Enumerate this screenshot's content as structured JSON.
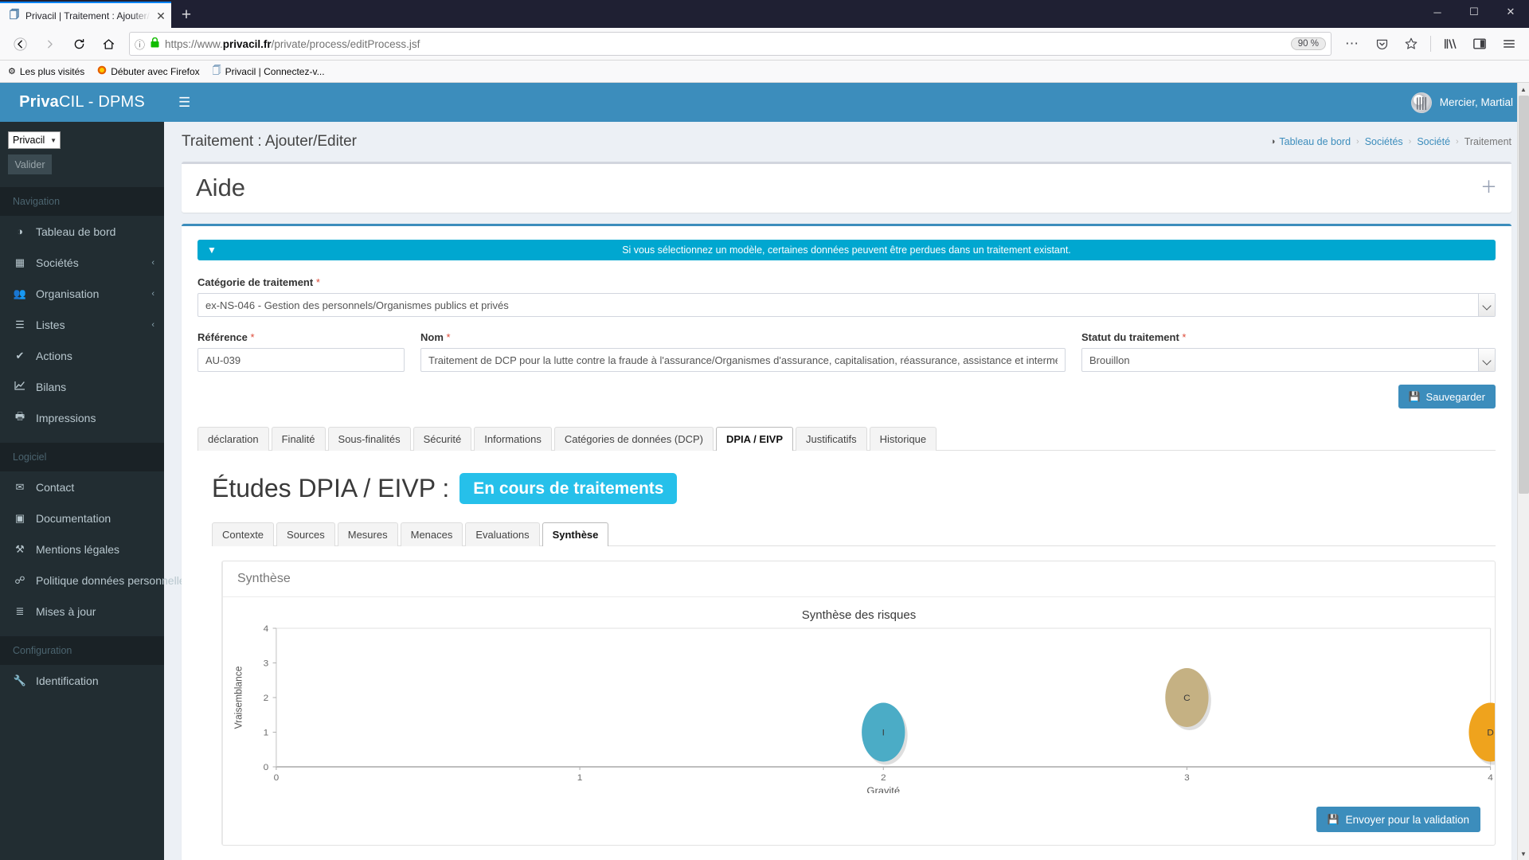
{
  "browser": {
    "tab": {
      "title": "Privacil | Traitement : Ajouter/E",
      "favicon": "privacil-favicon",
      "close": "✕"
    },
    "newtab_label": "+",
    "window_controls": {
      "minimize": "─",
      "maximize": "☐",
      "close": "✕"
    },
    "nav": {
      "back": "←",
      "forward": "→",
      "reload": "↻",
      "home": "⌂"
    },
    "url": {
      "protocol": "https://www.",
      "domain": "privacil.fr",
      "path": "/private/process/editProcess.jsf",
      "info_icon": "ⓘ",
      "lock_icon": "🔒"
    },
    "zoom_level": "90 %",
    "toolbar_icons": {
      "more": "⋯",
      "pocket": "pocket-icon",
      "bookmark_star": "☆",
      "library": "library-icon",
      "sidebar": "sidebar-icon",
      "menu": "☰"
    },
    "bookmarks": [
      {
        "label": "Les plus visités",
        "icon": "⚙"
      },
      {
        "label": "Débuter avec Firefox",
        "icon": "firefox-icon"
      },
      {
        "label": "Privacil | Connectez-v...",
        "icon": "privacil-favicon"
      }
    ]
  },
  "sidebar": {
    "brand_bold": "Priva",
    "brand_light": "CIL - DPMS",
    "company_select": {
      "value": "Privacil",
      "caret": "▼"
    },
    "valider_label": "Valider",
    "sections": [
      {
        "header": "Navigation",
        "items": [
          {
            "label": "Tableau de bord",
            "icon": "dashboard-icon",
            "glyph": "◔",
            "arrow": ""
          },
          {
            "label": "Sociétés",
            "icon": "building-icon",
            "glyph": "▦",
            "arrow": "‹"
          },
          {
            "label": "Organisation",
            "icon": "users-icon",
            "glyph": "♟",
            "arrow": "‹"
          },
          {
            "label": "Listes",
            "icon": "list-icon",
            "glyph": "☰",
            "arrow": "‹"
          },
          {
            "label": "Actions",
            "icon": "check-icon",
            "glyph": "✔",
            "arrow": ""
          },
          {
            "label": "Bilans",
            "icon": "chart-line-icon",
            "glyph": "↗",
            "arrow": ""
          },
          {
            "label": "Impressions",
            "icon": "printer-icon",
            "glyph": "⎙",
            "arrow": ""
          }
        ]
      },
      {
        "header": "Logiciel",
        "items": [
          {
            "label": "Contact",
            "icon": "envelope-icon",
            "glyph": "✉",
            "arrow": ""
          },
          {
            "label": "Documentation",
            "icon": "book-icon",
            "glyph": "◧",
            "arrow": ""
          },
          {
            "label": "Mentions légales",
            "icon": "gavel-icon",
            "glyph": "⚒",
            "arrow": ""
          },
          {
            "label": "Politique données personnelles",
            "icon": "link-icon",
            "glyph": "☍",
            "arrow": ""
          },
          {
            "label": "Mises à jour",
            "icon": "ordered-list-icon",
            "glyph": "≣",
            "arrow": ""
          }
        ]
      },
      {
        "header": "Configuration",
        "items": [
          {
            "label": "Identification",
            "icon": "wrench-icon",
            "glyph": "⚒",
            "arrow": ""
          }
        ]
      }
    ]
  },
  "topbar": {
    "hamburger": "☰",
    "user_name": "Mercier, Martial",
    "avatar": "user-avatar"
  },
  "page": {
    "title": "Traitement : Ajouter/Editer",
    "breadcrumb": [
      {
        "label": "Tableau de bord",
        "icon": "dashboard-icon",
        "glyph": "◔"
      },
      {
        "label": "Sociétés"
      },
      {
        "label": "Société"
      },
      {
        "label": "Traitement"
      }
    ],
    "breadcrumb_sep": "›",
    "aide_title": "Aide",
    "aide_plus": "＋"
  },
  "form": {
    "alert": {
      "icon": "▼",
      "text": "Si vous sélectionnez un modèle, certaines données peuvent être perdues dans un traitement existant."
    },
    "categorie": {
      "label": "Catégorie de traitement",
      "required": "*",
      "value": "ex-NS-046 - Gestion des personnels/Organismes publics et privés"
    },
    "reference": {
      "label": "Référence",
      "required": "*",
      "value": "AU-039"
    },
    "nom": {
      "label": "Nom",
      "required": "*",
      "value": "Traitement de DCP pour la lutte contre la fraude à l'assurance/Organismes d'assurance, capitalisation, réassurance, assistance et intermédiaires d'"
    },
    "statut": {
      "label": "Statut du traitement",
      "required": "*",
      "value": "Brouillon"
    },
    "save_button": {
      "label": "Sauvegarder",
      "icon": "💾"
    }
  },
  "main_tabs": {
    "items": [
      {
        "label": "déclaration",
        "active": false
      },
      {
        "label": "Finalité",
        "active": false
      },
      {
        "label": "Sous-finalités",
        "active": false
      },
      {
        "label": "Sécurité",
        "active": false
      },
      {
        "label": "Informations",
        "active": false
      },
      {
        "label": "Catégories de données (DCP)",
        "active": false
      },
      {
        "label": "DPIA / EIVP",
        "active": true
      },
      {
        "label": "Justificatifs",
        "active": false
      },
      {
        "label": "Historique",
        "active": false
      }
    ]
  },
  "dpia": {
    "heading": "Études DPIA / EIVP :",
    "status_badge": "En cours de traitements",
    "subtabs": [
      {
        "label": "Contexte",
        "active": false
      },
      {
        "label": "Sources",
        "active": false
      },
      {
        "label": "Mesures",
        "active": false
      },
      {
        "label": "Menaces",
        "active": false
      },
      {
        "label": "Evaluations",
        "active": false
      },
      {
        "label": "Synthèse",
        "active": true
      }
    ],
    "card_header": "Synthèse",
    "send_button": {
      "label": "Envoyer pour la validation",
      "icon": "💾"
    }
  },
  "chart_data": {
    "type": "scatter",
    "title": "Synthèse des risques",
    "xlabel": "Gravité",
    "ylabel": "Vraisemblance",
    "xlim": [
      0,
      4
    ],
    "ylim": [
      0,
      4
    ],
    "xticks": [
      "0",
      "1",
      "2",
      "3",
      "4"
    ],
    "yticks": [
      "0",
      "1",
      "2",
      "3",
      "4"
    ],
    "grid": false,
    "points": [
      {
        "label": "I",
        "x": 2,
        "y": 1,
        "color": "#4BACC6",
        "radius": 37
      },
      {
        "label": "C",
        "x": 3,
        "y": 2,
        "color": "#C5B183",
        "radius": 37
      },
      {
        "label": "D",
        "x": 4,
        "y": 1,
        "color": "#EFA31D",
        "radius": 37
      }
    ]
  },
  "scrollbar": {
    "up": "▲",
    "down": "▼"
  }
}
